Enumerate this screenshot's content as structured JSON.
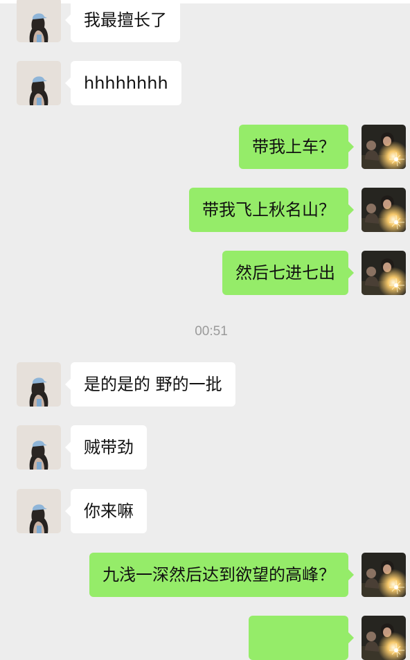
{
  "chat": {
    "timestamp": "00:51",
    "messages": [
      {
        "side": "left",
        "text": "我最擅长了"
      },
      {
        "side": "left",
        "text": "hhhhhhhh"
      },
      {
        "side": "right",
        "text": "带我上车？"
      },
      {
        "side": "right",
        "text": "带我飞上秋名山？"
      },
      {
        "side": "right",
        "text": "然后七进七出"
      },
      {
        "side": "left",
        "text": "是的是的 野的一批"
      },
      {
        "side": "left",
        "text": "贼带劲"
      },
      {
        "side": "left",
        "text": "你来嘛"
      },
      {
        "side": "right",
        "text": "九浅一深然后达到欲望的高峰？"
      },
      {
        "side": "right",
        "text": ""
      }
    ]
  },
  "colors": {
    "background": "#ededed",
    "incoming_bubble": "#ffffff",
    "outgoing_bubble": "#95ec69",
    "timestamp_text": "#9a9a9a"
  },
  "avatars": {
    "contact": "girl-with-cap-avatar",
    "self": "sparkler-photo-avatar"
  }
}
